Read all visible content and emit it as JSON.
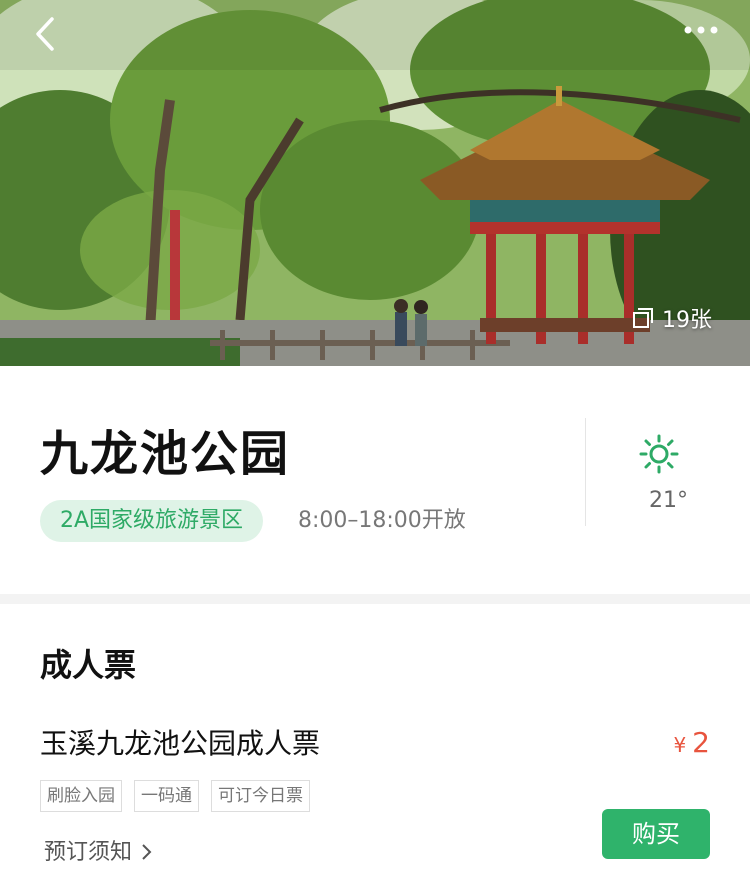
{
  "hero": {
    "photo_count": "19张",
    "colors": {
      "sky": "#cfe3b9",
      "foliage": "#4e7a32",
      "pavilion_roof": "#b0772f",
      "pillar": "#b3322c"
    }
  },
  "scenic": {
    "title": "九龙池公园",
    "level_tag": "2A国家级旅游景区",
    "hours": "8:00–18:00开放",
    "weather_icon": "sun-icon",
    "temperature": "21°"
  },
  "ticket": {
    "section_title": "成人票",
    "name": "玉溪九龙池公园成人票",
    "currency": "¥",
    "price": "2",
    "features": [
      "刷脸入园",
      "一码通",
      "可订今日票"
    ],
    "notice": "预订须知",
    "buy_label": "购买"
  },
  "colors": {
    "accent_green": "#2fb36b",
    "tag_bg": "#dff3e7",
    "price_red": "#e8543e"
  }
}
